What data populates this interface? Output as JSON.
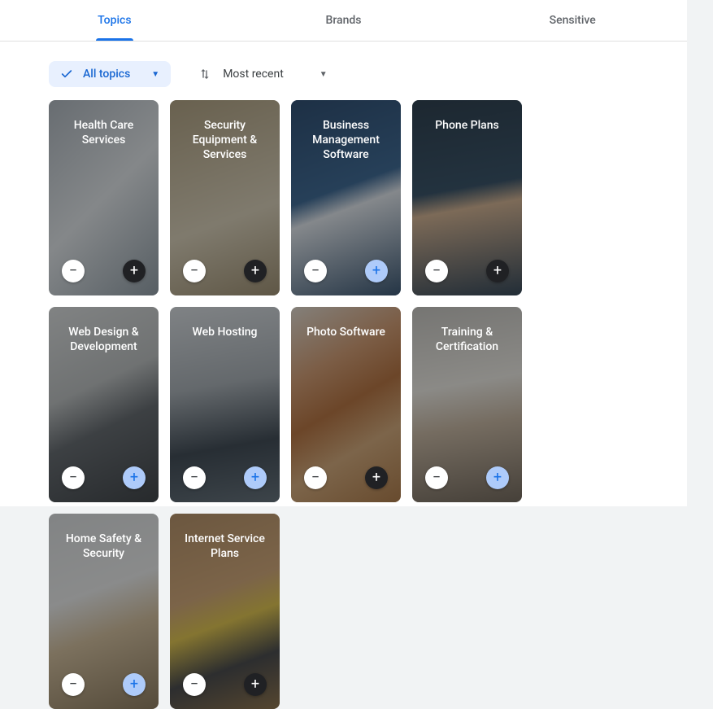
{
  "tabs": {
    "topics": "Topics",
    "brands": "Brands",
    "sensitive": "Sensitive",
    "active": "topics"
  },
  "filter": {
    "label": "All topics"
  },
  "sort": {
    "label": "Most recent"
  },
  "cards": [
    {
      "title": "Health Care Services",
      "minus_selected": false,
      "plus_selected": false,
      "plus_dark": true
    },
    {
      "title": "Security Equipment & Services",
      "minus_selected": false,
      "plus_selected": false,
      "plus_dark": true
    },
    {
      "title": "Business Management Software",
      "minus_selected": false,
      "plus_selected": true,
      "plus_dark": false
    },
    {
      "title": "Phone Plans",
      "minus_selected": false,
      "plus_selected": false,
      "plus_dark": true
    },
    {
      "title": "Web Design & Development",
      "minus_selected": false,
      "plus_selected": true,
      "plus_dark": false
    },
    {
      "title": "Web Hosting",
      "minus_selected": false,
      "plus_selected": true,
      "plus_dark": false
    },
    {
      "title": "Photo Software",
      "minus_selected": false,
      "plus_selected": false,
      "plus_dark": true
    },
    {
      "title": "Training & Certification",
      "minus_selected": false,
      "plus_selected": true,
      "plus_dark": false
    },
    {
      "title": "Home Safety & Security",
      "minus_selected": false,
      "plus_selected": true,
      "plus_dark": false
    },
    {
      "title": "Internet Service Plans",
      "minus_selected": false,
      "plus_selected": false,
      "plus_dark": true
    }
  ]
}
